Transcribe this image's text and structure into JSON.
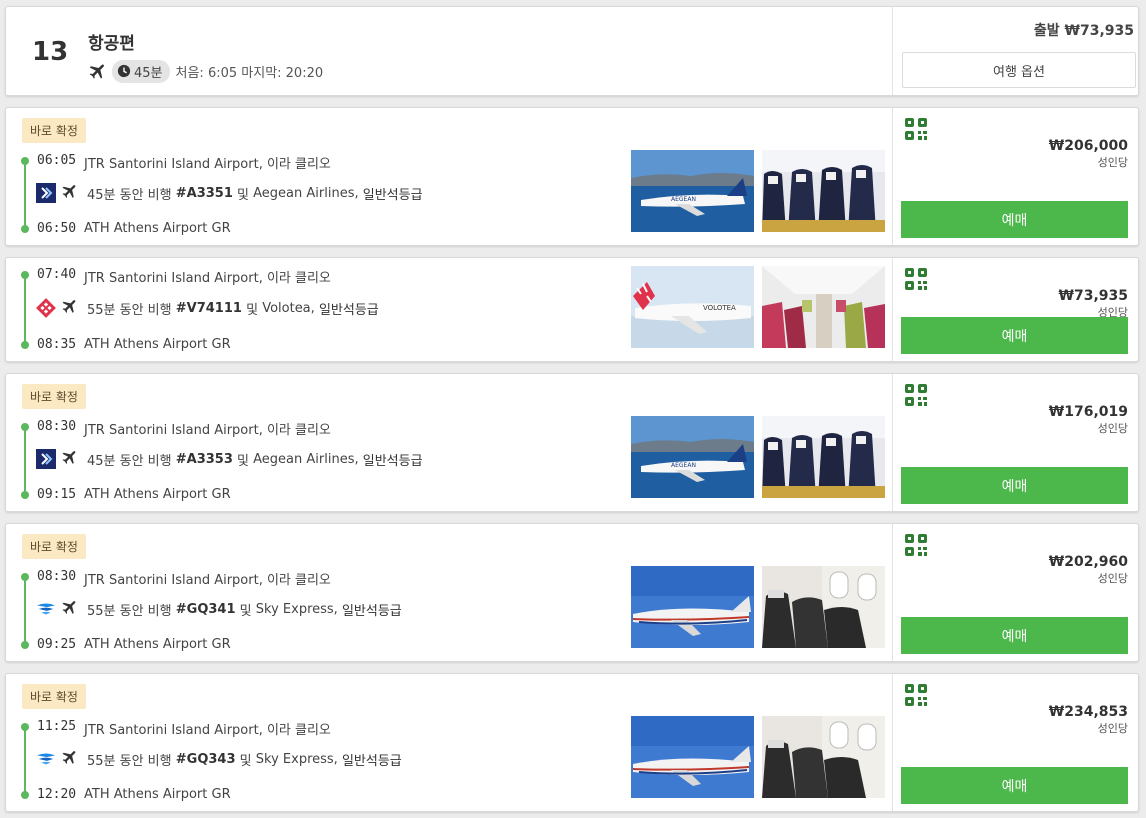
{
  "header": {
    "number": "13",
    "title": "항공편",
    "duration": "45분",
    "range": "처음: 6:05 마지막: 20:20",
    "price_from": "출발 ₩73,935",
    "options_label": "여행 옵션"
  },
  "flights": [
    {
      "badge": "바로 확정",
      "dep_time": "06:05",
      "dep_airport": "JTR Santorini Island Airport, 이라 클리오",
      "arr_time": "06:50",
      "arr_airport": "ATH Athens Airport GR",
      "desc_pre": "45분 동안 비행",
      "flight_no": "#A3351",
      "desc_and": "및",
      "airline": "Aegean Airlines,",
      "cabin": "일반석등급",
      "price": "₩206,000",
      "per": "성인당",
      "book": "예매",
      "logo": "aegean",
      "img1": "aegean-plane-photo",
      "img2": "aegean-cabin-photo"
    },
    {
      "badge": "",
      "dep_time": "07:40",
      "dep_airport": "JTR Santorini Island Airport, 이라 클리오",
      "arr_time": "08:35",
      "arr_airport": "ATH Athens Airport GR",
      "desc_pre": "55분 동안 비행",
      "flight_no": "#V74111",
      "desc_and": "및",
      "airline": "Volotea,",
      "cabin": "일반석등급",
      "price": "₩73,935",
      "per": "성인당",
      "book": "예매",
      "logo": "volotea",
      "img1": "volotea-plane-photo",
      "img2": "volotea-cabin-photo"
    },
    {
      "badge": "바로 확정",
      "dep_time": "08:30",
      "dep_airport": "JTR Santorini Island Airport, 이라 클리오",
      "arr_time": "09:15",
      "arr_airport": "ATH Athens Airport GR",
      "desc_pre": "45분 동안 비행",
      "flight_no": "#A3353",
      "desc_and": "및",
      "airline": "Aegean Airlines,",
      "cabin": "일반석등급",
      "price": "₩176,019",
      "per": "성인당",
      "book": "예매",
      "logo": "aegean",
      "img1": "aegean-plane-photo",
      "img2": "aegean-cabin-photo"
    },
    {
      "badge": "바로 확정",
      "dep_time": "08:30",
      "dep_airport": "JTR Santorini Island Airport, 이라 클리오",
      "arr_time": "09:25",
      "arr_airport": "ATH Athens Airport GR",
      "desc_pre": "55분 동안 비행",
      "flight_no": "#GQ341",
      "desc_and": "및",
      "airline": "Sky Express,",
      "cabin": "일반석등급",
      "price": "₩202,960",
      "per": "성인당",
      "book": "예매",
      "logo": "skyexpress",
      "img1": "skyexpress-plane-photo",
      "img2": "skyexpress-cabin-photo"
    },
    {
      "badge": "바로 확정",
      "dep_time": "11:25",
      "dep_airport": "JTR Santorini Island Airport, 이라 클리오",
      "arr_time": "12:20",
      "arr_airport": "ATH Athens Airport GR",
      "desc_pre": "55분 동안 비행",
      "flight_no": "#GQ343",
      "desc_and": "및",
      "airline": "Sky Express,",
      "cabin": "일반석등급",
      "price": "₩234,853",
      "per": "성인당",
      "book": "예매",
      "logo": "skyexpress",
      "img1": "skyexpress-plane-photo",
      "img2": "skyexpress-cabin-photo"
    }
  ],
  "colors": {
    "book_green": "#4cb74a",
    "timeline_green": "#5cb85c",
    "badge_bg": "#fbe9c4",
    "qr_green": "#2e7d32"
  },
  "icons": {
    "plane": "plane-icon",
    "clock": "clock-icon",
    "qr": "qr-code-icon"
  }
}
